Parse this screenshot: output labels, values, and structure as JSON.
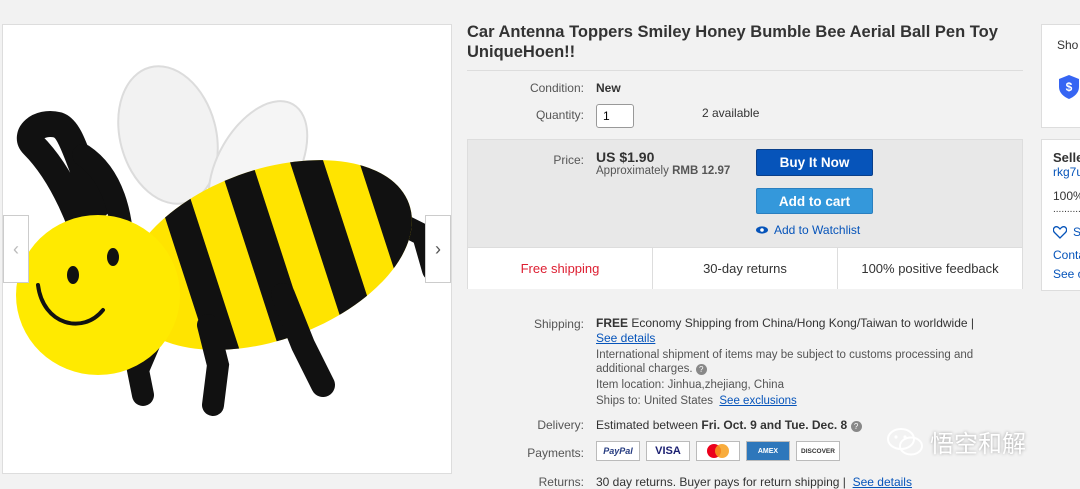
{
  "product": {
    "title": "Car Antenna Toppers Smiley Honey Bumble Bee Aerial Ball Pen Toy UniqueHoen!!"
  },
  "gallery": {
    "prev_arrow": "‹",
    "next_arrow": "›"
  },
  "condition": {
    "label": "Condition:",
    "value": "New"
  },
  "quantity": {
    "label": "Quantity:",
    "value": "1",
    "available": "2 available"
  },
  "price": {
    "label": "Price:",
    "value": "US $1.90",
    "approx_prefix": "Approximately",
    "approx_value": "RMB 12.97"
  },
  "actions": {
    "buy_now": "Buy It Now",
    "add_to_cart": "Add to cart",
    "watchlist": "Add to Watchlist"
  },
  "features": {
    "shipping": "Free shipping",
    "returns": "30-day returns",
    "feedback": "100% positive feedback"
  },
  "shipping": {
    "label": "Shipping:",
    "free": "FREE",
    "method": "Economy Shipping from China/Hong Kong/Taiwan to worldwide |",
    "details_link": "See details",
    "intl_note": "International shipment of items may be subject to customs processing and additional charges.",
    "location_label": "Item location:",
    "location_value": "Jinhua,zhejiang, China",
    "ships_to_label": "Ships to:",
    "ships_to_value": "United States",
    "exclusions_link": "See exclusions"
  },
  "delivery": {
    "label": "Delivery:",
    "prefix": "Estimated between",
    "range": "Fri. Oct. 9 and Tue. Dec. 8"
  },
  "payments": {
    "label": "Payments:",
    "methods": [
      "PayPal",
      "VISA",
      "MasterCard",
      "AMEX",
      "DISCOVER"
    ]
  },
  "returns": {
    "label": "Returns:",
    "text": "30 day returns. Buyer pays for return shipping |",
    "details_link": "See details"
  },
  "right_panel": {
    "shop_text": "Sho",
    "seller_title": "Selle",
    "seller_name": "rkg7u",
    "seller_pct": "100%",
    "seller_dots": "..........",
    "save_text": "S",
    "contact_text": "Conta",
    "see_text": "See o"
  },
  "watermark": {
    "text": "悟空和解"
  },
  "colors": {
    "buy_now": "#0654ba",
    "add_to_cart": "#3498db",
    "free_shipping": "#dd1e31",
    "link": "#0654ba",
    "bee_yellow": "#ffea00"
  }
}
